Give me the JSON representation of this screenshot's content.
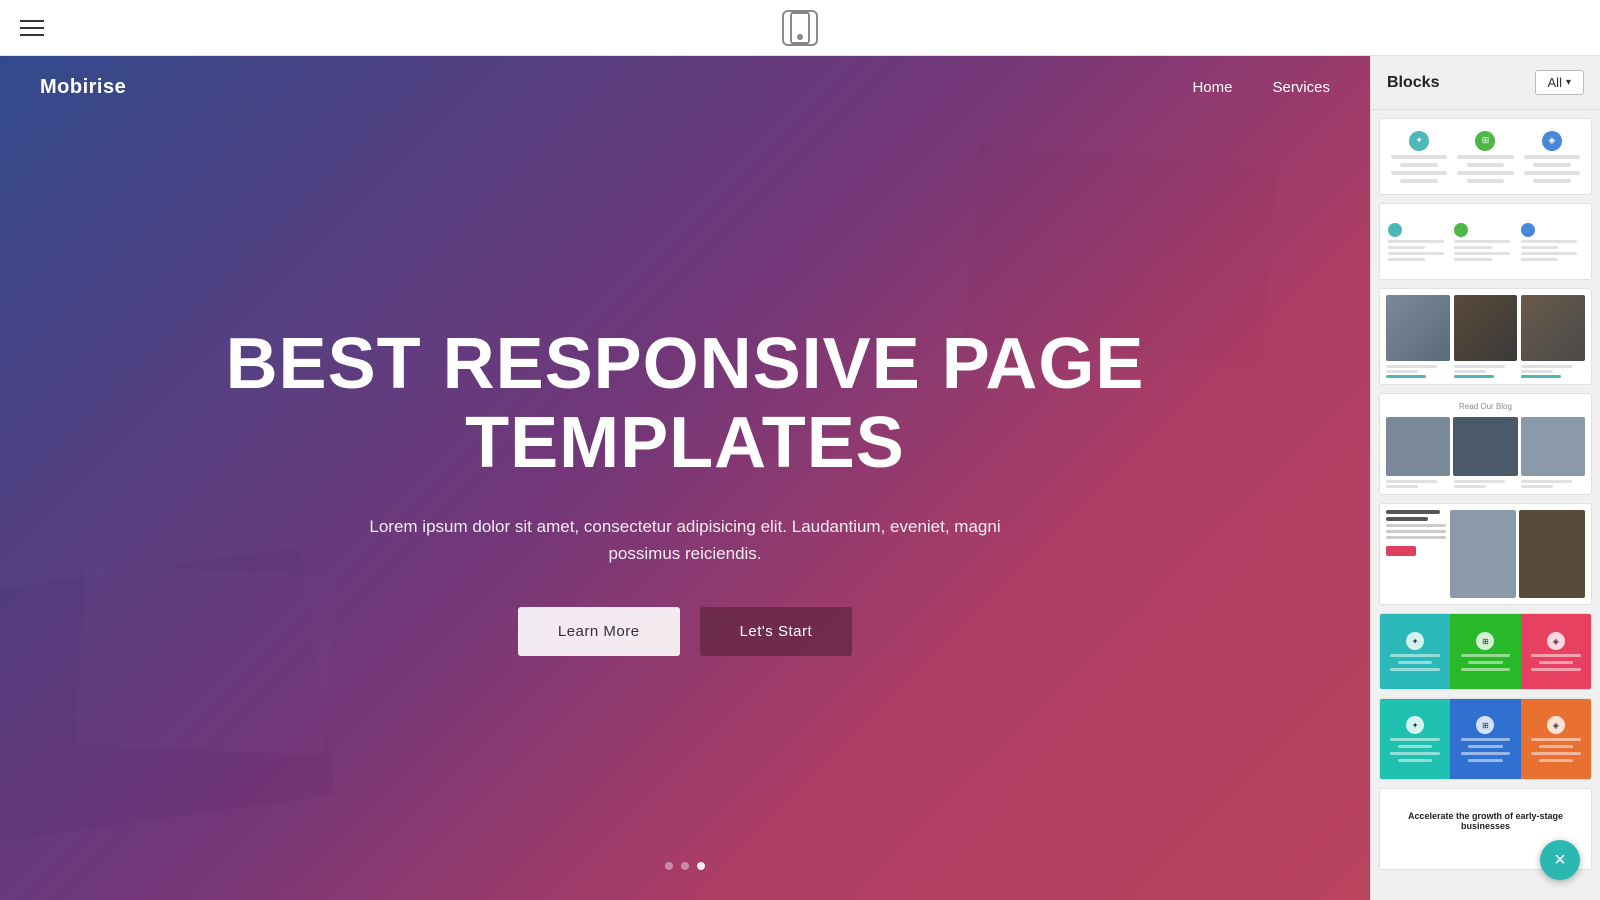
{
  "topBar": {
    "menuIcon": "menu-icon",
    "deviceIcon": "mobile-device-icon"
  },
  "canvas": {
    "hero": {
      "logo": "Mobirise",
      "nav": {
        "links": [
          {
            "label": "Home",
            "href": "#"
          },
          {
            "label": "Services",
            "href": "#"
          }
        ]
      },
      "title": "BEST RESPONSIVE PAGE TEMPLATES",
      "subtitle": "Lorem ipsum dolor sit amet, consectetur adipisicing elit. Laudantium, eveniet, magni possimus reiciendis.",
      "buttons": {
        "learnMore": "Learn More",
        "letsStart": "Let's Start"
      },
      "dots": [
        false,
        false,
        true
      ]
    }
  },
  "rightPanel": {
    "title": "Blocks",
    "filterBtn": "All",
    "filterIcon": "chevron-down-icon",
    "blocks": [
      {
        "id": "block-features-icons",
        "type": "features-icons"
      },
      {
        "id": "block-features-dots",
        "type": "features-dots"
      },
      {
        "id": "block-photo-grid",
        "type": "photo-grid"
      },
      {
        "id": "block-blog-grid",
        "type": "blog-grid",
        "label": "Read Our Blog"
      },
      {
        "id": "block-news-split",
        "type": "news-split"
      },
      {
        "id": "block-colored-cols",
        "type": "colored-cols"
      },
      {
        "id": "block-teal-cols",
        "type": "teal-cols"
      },
      {
        "id": "block-marketing-text",
        "type": "marketing-text",
        "label": "Accelerate the growth of early-stage businesses"
      }
    ]
  },
  "closeBtn": "×"
}
